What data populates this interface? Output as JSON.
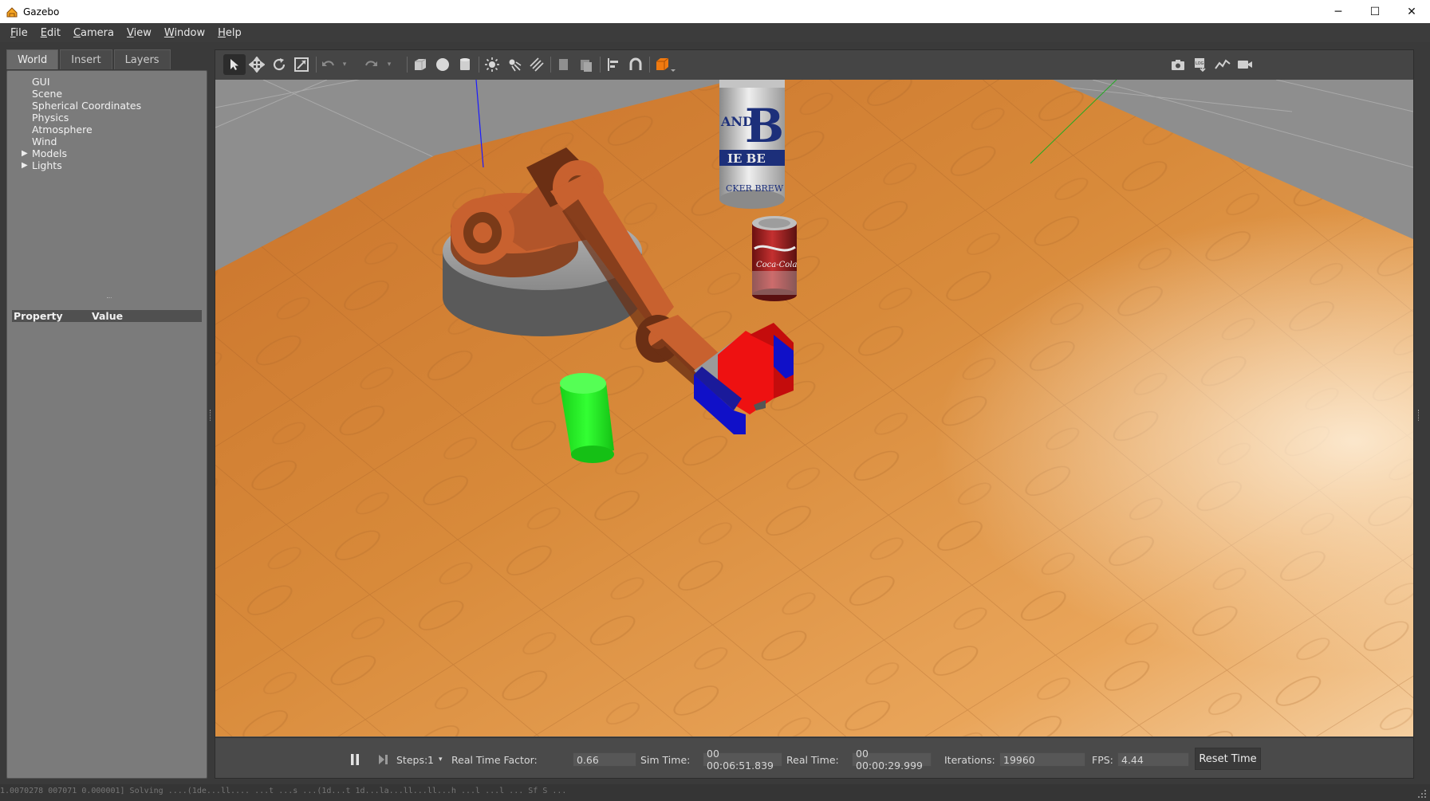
{
  "window": {
    "title": "Gazebo",
    "icon": "gazebo-app-icon",
    "controls": {
      "minimize": "─",
      "maximize": "☐",
      "close": "✕"
    }
  },
  "menu": [
    {
      "label": "File",
      "ul": "F",
      "rest": "ile"
    },
    {
      "label": "Edit",
      "ul": "E",
      "rest": "dit"
    },
    {
      "label": "Camera",
      "ul": "C",
      "rest": "amera"
    },
    {
      "label": "View",
      "ul": "V",
      "rest": "iew"
    },
    {
      "label": "Window",
      "ul": "W",
      "rest": "indow"
    },
    {
      "label": "Help",
      "ul": "H",
      "rest": "elp"
    }
  ],
  "left_panel": {
    "tabs": [
      "World",
      "Insert",
      "Layers"
    ],
    "active_tab": "World",
    "tree": [
      {
        "label": "GUI",
        "expandable": false
      },
      {
        "label": "Scene",
        "expandable": false
      },
      {
        "label": "Spherical Coordinates",
        "expandable": false
      },
      {
        "label": "Physics",
        "expandable": false
      },
      {
        "label": "Atmosphere",
        "expandable": false
      },
      {
        "label": "Wind",
        "expandable": false
      },
      {
        "label": "Models",
        "expandable": true
      },
      {
        "label": "Lights",
        "expandable": true
      }
    ],
    "property_header": {
      "property": "Property",
      "value": "Value"
    }
  },
  "toolbar": {
    "left_tools": [
      "select-mode-icon",
      "translate-mode-icon",
      "rotate-mode-icon",
      "scale-mode-icon",
      "undo-icon",
      "undo-history-icon",
      "redo-icon",
      "redo-history-icon",
      "box-shape-icon",
      "sphere-shape-icon",
      "cylinder-shape-icon",
      "point-light-icon",
      "spot-light-icon",
      "directional-light-icon",
      "copy-icon",
      "paste-icon",
      "align-icon",
      "snap-icon",
      "view-angle-icon"
    ],
    "right_tools": [
      "screenshot-icon",
      "log-icon",
      "plot-icon",
      "video-record-icon"
    ]
  },
  "status": {
    "steps_label": "Steps:",
    "steps_value": "1",
    "rtf_label": "Real Time Factor:",
    "rtf_value": "0.66",
    "sim_time_label": "Sim Time:",
    "sim_time_value": "00 00:06:51.839",
    "real_time_label": "Real Time:",
    "real_time_value": "00 00:00:29.999",
    "iterations_label": "Iterations:",
    "iterations_value": "19960",
    "fps_label": "FPS:",
    "fps_value": "4.44",
    "reset_label": "Reset Time"
  },
  "scene_text": {
    "can_letter": "B",
    "can_band": "AND",
    "can_sub": "IE BE",
    "can_footer": "CKER BREW",
    "coke_text": "Coca-Cola"
  },
  "colors": {
    "menubar_bg": "#3c3c3c",
    "panel_bg": "#7b7b7b",
    "toolbar_bg": "#454545",
    "robot_orange": "#c8612f",
    "gripper_red": "#ee1111",
    "gripper_blue": "#1010c8",
    "green_cylinder": "#22ee22",
    "floor_wood": "#d88a3a"
  },
  "bottom_log": "1.0070278 007071   0.000001]  Solving    ....(1de...ll....  ...t  ...s  ...(1d...t   1d...la...ll...ll...h  ...l  ...l  ...  Sf  S  ..."
}
